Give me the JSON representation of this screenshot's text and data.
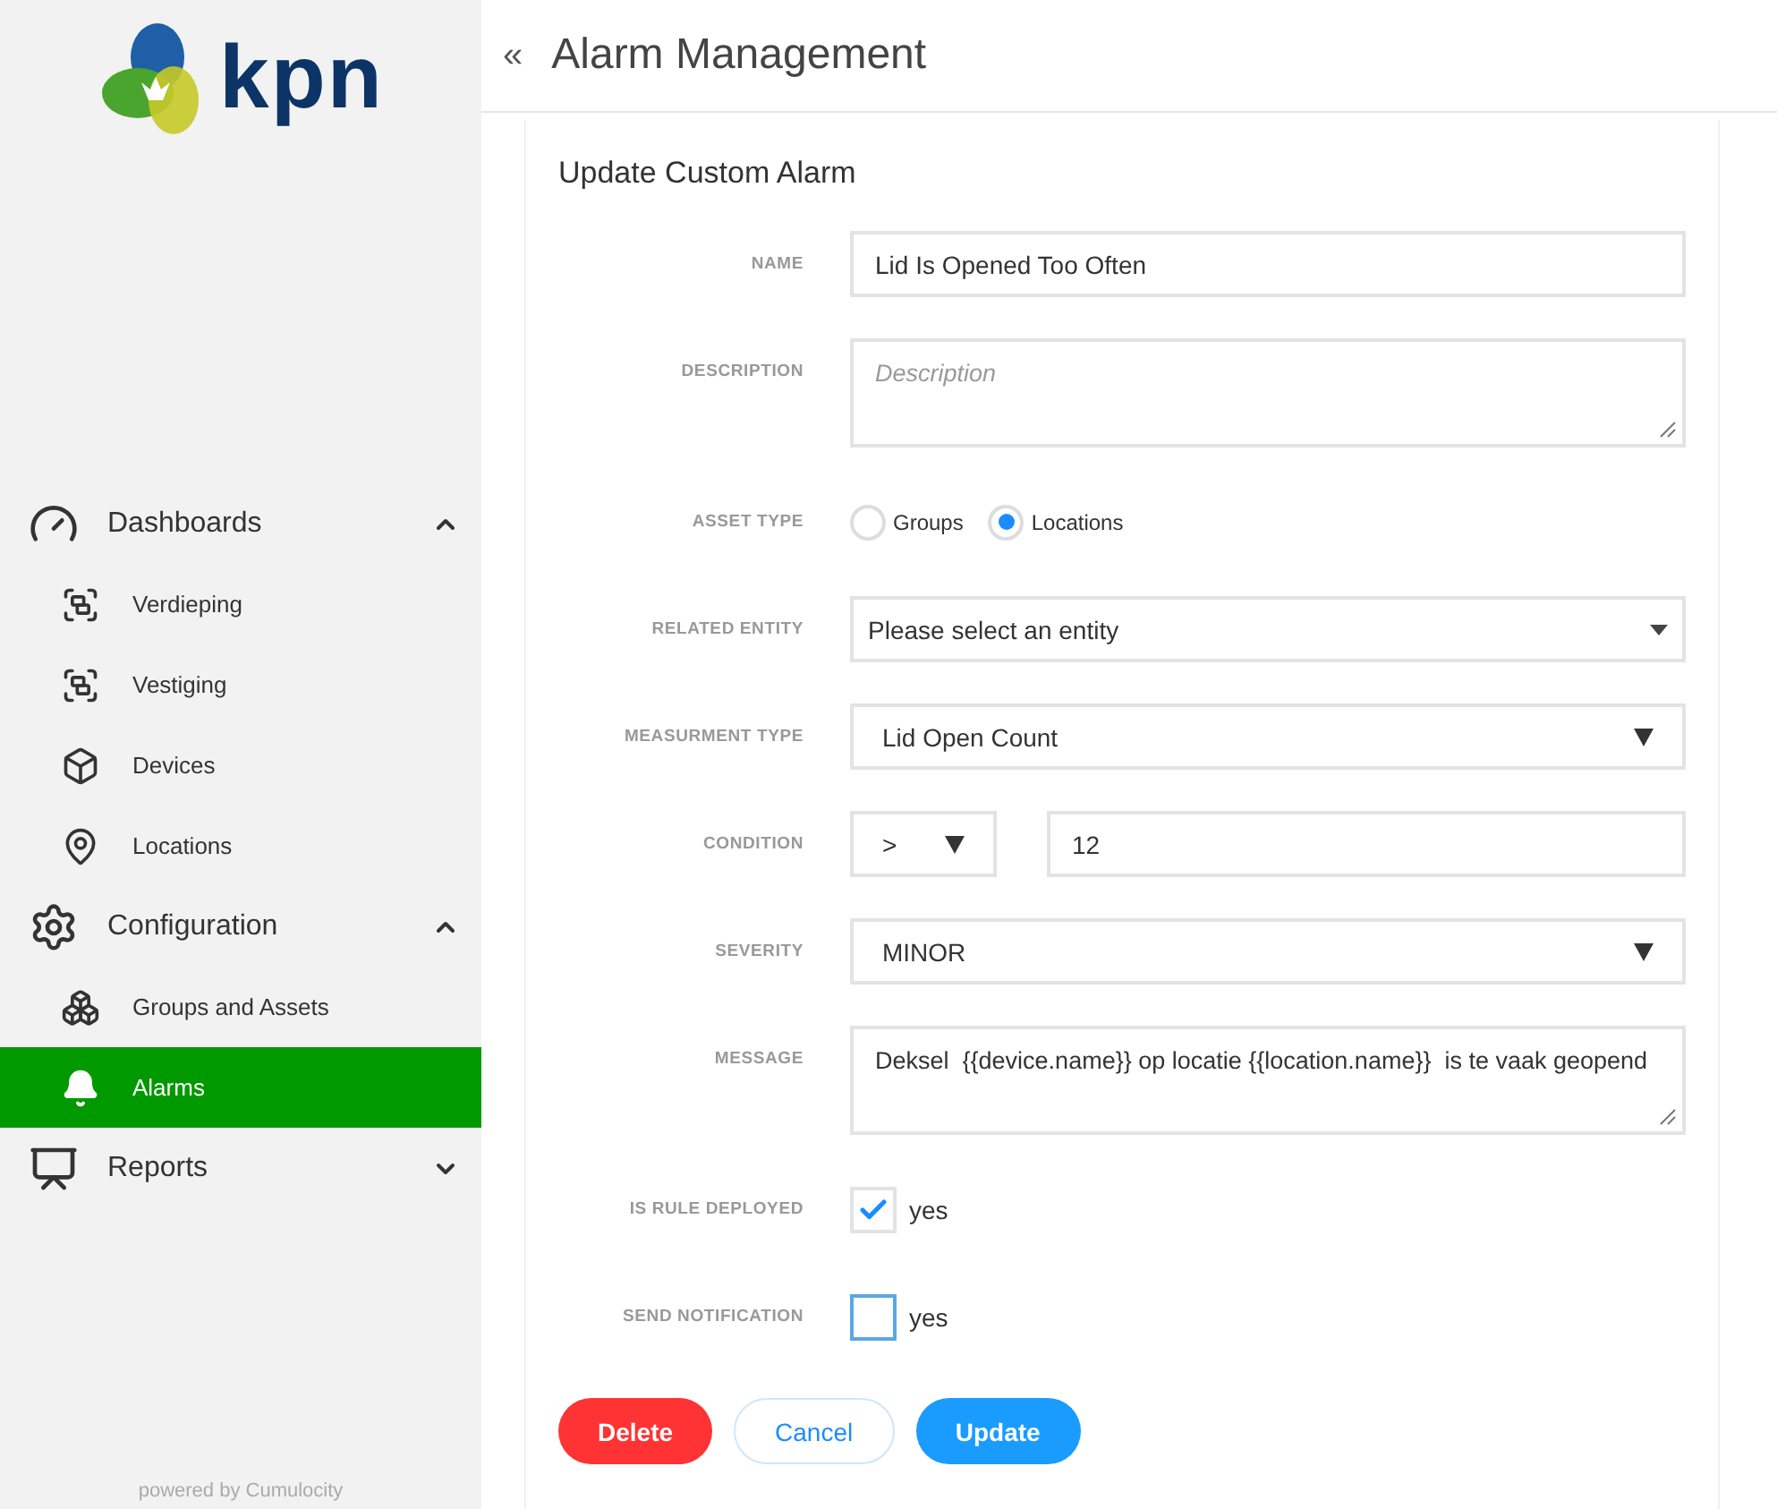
{
  "logo": {
    "text": "kpn"
  },
  "sidebar": {
    "items": [
      {
        "label": "Dashboards",
        "expanded": true,
        "children": [
          {
            "label": "Verdieping",
            "selected": false
          },
          {
            "label": "Vestiging",
            "selected": false
          },
          {
            "label": "Devices",
            "selected": false
          },
          {
            "label": "Locations",
            "selected": false
          }
        ]
      },
      {
        "label": "Configuration",
        "expanded": true,
        "children": [
          {
            "label": "Groups and Assets",
            "selected": false
          },
          {
            "label": "Alarms",
            "selected": true
          }
        ]
      },
      {
        "label": "Reports",
        "expanded": false
      }
    ],
    "footer": "powered by Cumulocity"
  },
  "header": {
    "collapse": "«",
    "title": "Alarm Management"
  },
  "form": {
    "title": "Update Custom Alarm",
    "fields": [
      {
        "kind": "text",
        "label": "NAME",
        "value": "Lid Is Opened Too Often"
      },
      {
        "kind": "textarea",
        "label": "DESCRIPTION",
        "placeholder": "Description"
      },
      {
        "kind": "radio",
        "label": "ASSET TYPE",
        "options": [
          {
            "label": "Groups",
            "selected": false
          },
          {
            "label": "Locations",
            "selected": true
          }
        ]
      },
      {
        "kind": "select",
        "label": "RELATED ENTITY",
        "value": "Please select an entity"
      },
      {
        "kind": "select",
        "label": "MEASURMENT TYPE",
        "value": "Lid Open Count"
      },
      {
        "kind": "condition",
        "label": "CONDITION",
        "operator": ">",
        "value": "12"
      },
      {
        "kind": "select",
        "label": "SEVERITY",
        "value": "MINOR"
      },
      {
        "kind": "textarea",
        "label": "MESSAGE",
        "value": "Deksel  {{device.name}} op locatie {{location.name}}  is te vaak geopend"
      },
      {
        "kind": "checkbox",
        "label": "IS RULE DEPLOYED",
        "text": "yes",
        "checked": true
      },
      {
        "kind": "checkbox",
        "label": "SEND NOTIFICATION",
        "text": "yes",
        "checked": false
      }
    ],
    "buttons": [
      {
        "label": "Delete",
        "kind": "danger"
      },
      {
        "label": "Cancel",
        "kind": "outline"
      },
      {
        "label": "Update",
        "kind": "primary"
      }
    ]
  }
}
